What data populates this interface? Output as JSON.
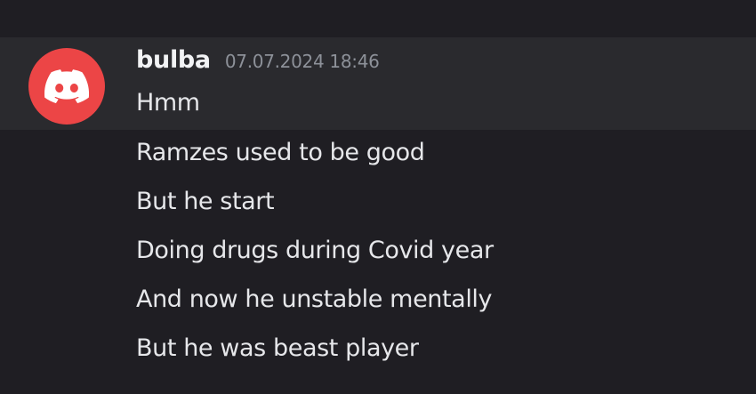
{
  "message": {
    "author": "bulba",
    "timestamp": "07.07.2024 18:46",
    "avatar_icon": "discord-logo-icon",
    "avatar_color": "#ec4546",
    "lines": [
      "Hmm",
      "Ramzes used to be good",
      "But he start",
      "Doing drugs during Covid year",
      "And now he unstable mentally",
      "But he was beast player"
    ]
  }
}
